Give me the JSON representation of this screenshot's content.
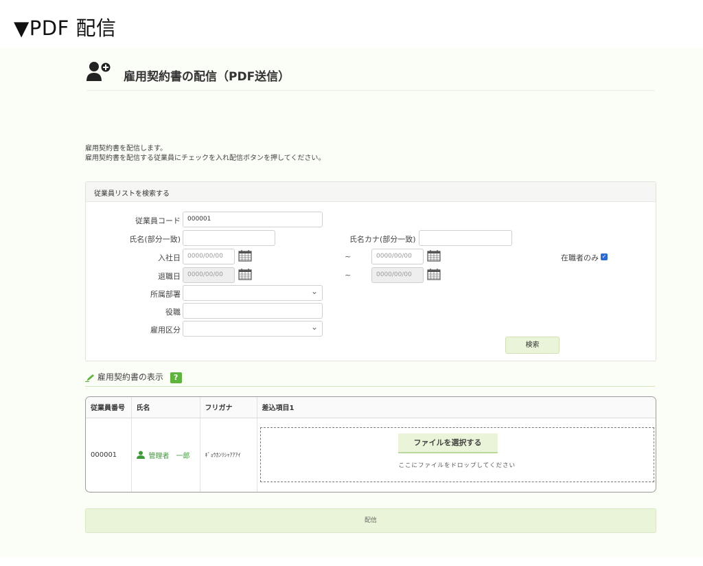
{
  "heading": "▼PDF 配信",
  "page": {
    "title": "雇用契約書の配信（PDF送信）"
  },
  "description": {
    "line1": "雇用契約書を配信します。",
    "line2": "雇用契約書を配信する従業員にチェックを入れ配信ボタンを押してください。"
  },
  "search": {
    "panel_title": "従業員リストを検索する",
    "labels": {
      "employee_code": "従業員コード",
      "name_partial": "氏名(部分一致)",
      "kana_partial": "氏名カナ(部分一致)",
      "hire_date": "入社日",
      "leave_date": "退職日",
      "department": "所属部署",
      "position": "役職",
      "employment_type": "雇用区分",
      "active_only": "在職者のみ"
    },
    "values": {
      "employee_code": "000001",
      "name_partial": "",
      "kana_partial": "",
      "hire_from": "0000/00/00",
      "hire_to": "0000/00/00",
      "leave_from": "0000/00/00",
      "leave_to": "0000/00/00",
      "department": "",
      "position": "",
      "employment_type": ""
    },
    "tilde": "~",
    "active_only_checked": true,
    "button": "検索"
  },
  "section": {
    "title": "雇用契約書の表示",
    "help": "?"
  },
  "table": {
    "headers": [
      "従業員番号",
      "氏名",
      "フリガナ",
      "差込項目1"
    ],
    "rows": [
      {
        "number": "000001",
        "name": "管理者　一郎",
        "kana": "ｷﾞｮｳｶﾝﾘｼｬｱｱｱｲ"
      }
    ],
    "file_button": "ファイルを選択する",
    "drop_hint": "ここにファイルをドロップしてください"
  },
  "deliver_button": "配信",
  "colors": {
    "accent_green": "#5fb53b",
    "button_bg": "#eaf4d8",
    "checkbox_blue": "#2a6bd6"
  }
}
